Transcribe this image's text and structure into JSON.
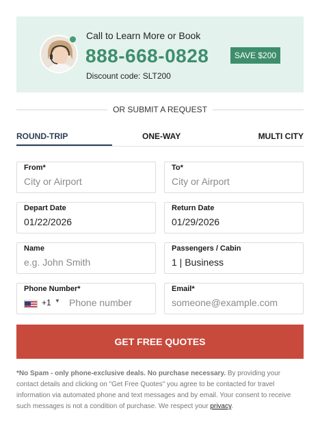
{
  "call_box": {
    "title": "Call to Learn More or Book",
    "phone": "888-668-0828",
    "save_badge": "SAVE $200",
    "discount": "Discount code: SLT200"
  },
  "divider": {
    "text": "OR SUBMIT A REQUEST"
  },
  "tabs": [
    {
      "label": "ROUND-TRIP",
      "active": true
    },
    {
      "label": "ONE-WAY",
      "active": false
    },
    {
      "label": "MULTI CITY",
      "active": false
    }
  ],
  "form": {
    "from": {
      "label": "From*",
      "placeholder": "City or Airport"
    },
    "to": {
      "label": "To*",
      "placeholder": "City or Airport"
    },
    "depart": {
      "label": "Depart Date",
      "value": "01/22/2026"
    },
    "return": {
      "label": "Return Date",
      "value": "01/29/2026"
    },
    "name": {
      "label": "Name",
      "placeholder": "e.g. John Smith"
    },
    "passengers": {
      "label": "Passengers / Cabin",
      "value": "1 | Business"
    },
    "phone": {
      "label": "Phone Number*",
      "country_code": "+1",
      "placeholder": "Phone number",
      "flag_icon": "us-flag-icon"
    },
    "email": {
      "label": "Email*",
      "placeholder": "someone@example.com"
    }
  },
  "cta": {
    "label": "GET FREE QUOTES"
  },
  "disclaimer": {
    "bold1": "*No Spam - only phone-exclusive deals.",
    "bold2": "No purchase necessary.",
    "body": "By providing your contact details and clicking on \"Get Free Quotes\" you agree to be contacted for travel information via automated phone and text messages and by email. Your consent to receive such messages is not a condition of purchase. We respect your",
    "link": "privacy",
    "end": "."
  },
  "colors": {
    "brand_green": "#3e8e6c",
    "call_bg": "#e4f2ed",
    "cta_red": "#c84a3c",
    "tab_active": "#2d3d55"
  }
}
